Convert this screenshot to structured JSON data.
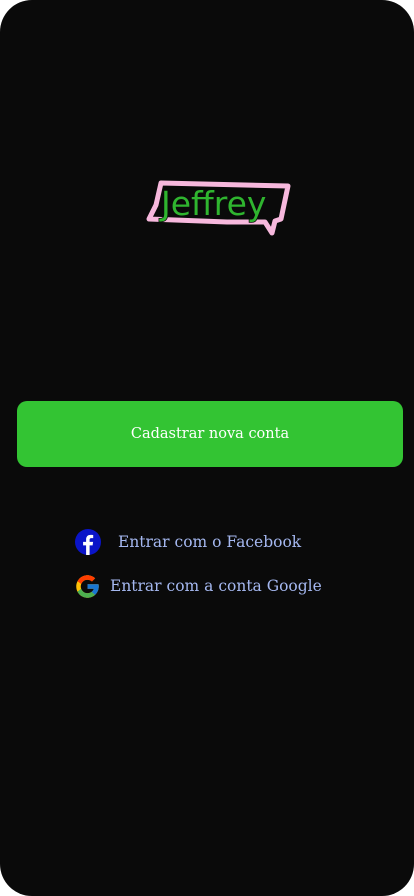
{
  "app": {
    "logo_text": "Jeffrey"
  },
  "colors": {
    "background": "#0a0a0a",
    "primary_button": "#33c433",
    "link_text": "#a5b8f0",
    "logo_fill": "#2fb52f",
    "logo_outline": "#f7b8dd",
    "facebook_blue": "#0a14c8"
  },
  "actions": {
    "register_label": "Cadastrar nova conta",
    "facebook_label": "Entrar com o Facebook",
    "google_label": "Entrar com a conta Google"
  },
  "icons": {
    "facebook": "facebook-icon",
    "google": "google-icon"
  }
}
